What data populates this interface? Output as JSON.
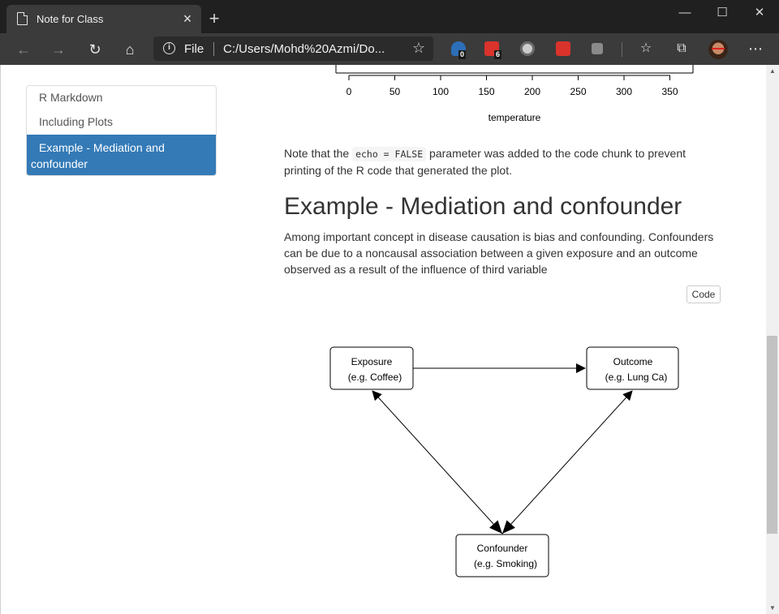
{
  "browser": {
    "tab_title": "Note for Class",
    "tab_close": "×",
    "new_tab": "+",
    "window_controls": {
      "minimize": "—",
      "maximize": "☐",
      "close": "✕"
    },
    "address_prefix": "File",
    "url": "C:/Users/Mohd%20Azmi/Do...",
    "extensions": [
      {
        "name": "badge-extension",
        "badge": "0"
      },
      {
        "name": "red-extension",
        "badge": "6"
      }
    ]
  },
  "toc": {
    "items": [
      {
        "label": "R Markdown",
        "active": false
      },
      {
        "label": "Including Plots",
        "active": false
      },
      {
        "label": "Example - Mediation and confounder",
        "active": true
      }
    ]
  },
  "plot": {
    "x_ticks": [
      "0",
      "50",
      "100",
      "150",
      "200",
      "250",
      "300",
      "350"
    ],
    "x_label": "temperature"
  },
  "note": {
    "before": "Note that the ",
    "code": "echo = FALSE",
    "after": " parameter was added to the code chunk to prevent printing of the R code that generated the plot."
  },
  "section": {
    "title": "Example - Mediation and confounder",
    "paragraph": "Among important concept in disease causation is bias and confounding. Confounders can be due to a noncausal association between a given exposure and an outcome observed as a result of the influence of third variable"
  },
  "code_button": "Code",
  "diagram": {
    "nodes": {
      "exposure": {
        "line1": "Exposure",
        "line2": "(e.g. Coffee)"
      },
      "outcome": {
        "line1": "Outcome",
        "line2": "(e.g. Lung Ca)"
      },
      "confounder": {
        "line1": "Confounder",
        "line2": "(e.g. Smoking)"
      }
    }
  }
}
